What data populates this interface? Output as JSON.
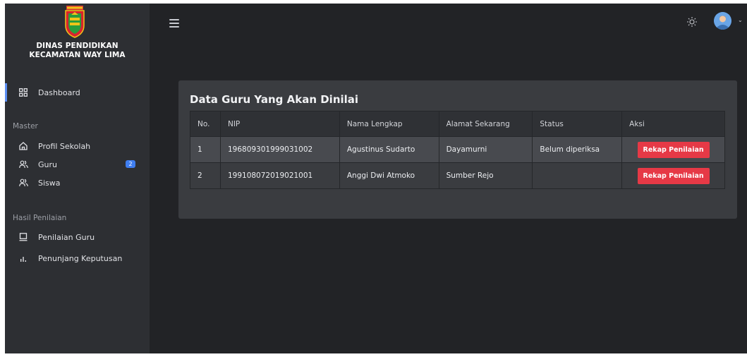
{
  "brand": {
    "line1": "DINAS PENDIDIKAN",
    "line2": "KECAMATAN WAY LIMA",
    "logo_icon": "pesawaran-crest-icon"
  },
  "sidebar": {
    "dashboard": {
      "label": "Dashboard",
      "icon": "dashboard-grid-icon"
    },
    "master_label": "Master",
    "master_items": [
      {
        "label": "Profil Sekolah",
        "icon": "home-icon"
      },
      {
        "label": "Guru",
        "icon": "users-icon",
        "badge": "2"
      },
      {
        "label": "Siswa",
        "icon": "users-icon"
      }
    ],
    "hasil_label": "Hasil Penilaian",
    "hasil_items": [
      {
        "label": "Penilaian Guru",
        "icon": "monitor-icon"
      },
      {
        "label": "Penunjang Keputusan",
        "icon": "bar-chart-icon"
      }
    ]
  },
  "topbar": {
    "menu_icon": "hamburger-icon",
    "theme_icon": "sun-icon",
    "avatar_icon": "user-avatar-icon"
  },
  "card": {
    "title": "Data Guru Yang Akan Dinilai",
    "columns": [
      "No.",
      "NIP",
      "Nama Lengkap",
      "Alamat Sekarang",
      "Status",
      "Aksi"
    ],
    "rows": [
      {
        "no": "1",
        "nip": "196809301999031002",
        "nama": "Agustinus Sudarto",
        "alamat": "Dayamurni",
        "status": "Belum diperiksa",
        "aksi": "Rekap Penilaian"
      },
      {
        "no": "2",
        "nip": "199108072019021001",
        "nama": "Anggi Dwi Atmoko",
        "alamat": "Sumber Rejo",
        "status": "",
        "aksi": "Rekap Penilaian"
      }
    ]
  },
  "colors": {
    "accent": "#5c8ef2",
    "danger_button": "#e63946",
    "badge": "#3f7ef0"
  }
}
